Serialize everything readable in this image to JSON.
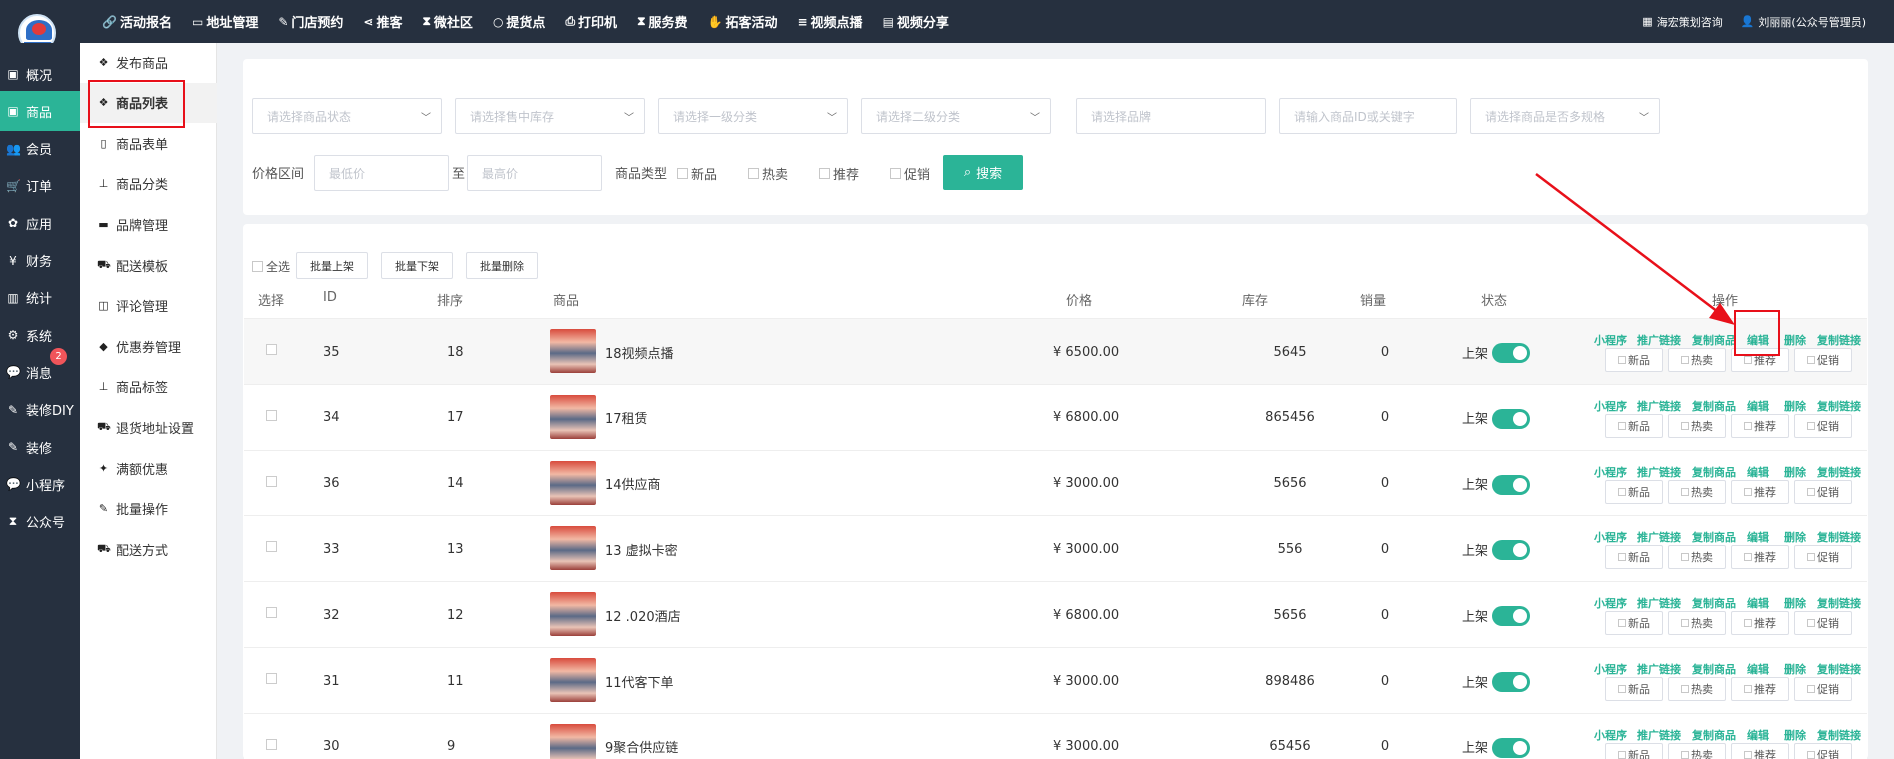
{
  "topbar": {
    "nav": [
      {
        "icon": "link-icon",
        "glyph": "🔗",
        "label": "活动报名"
      },
      {
        "icon": "card-icon",
        "glyph": "▭",
        "label": "地址管理"
      },
      {
        "icon": "pin-icon",
        "glyph": "✎",
        "label": "门店预约"
      },
      {
        "icon": "share-icon",
        "glyph": "⋖",
        "label": "推客"
      },
      {
        "icon": "hourglass-icon",
        "glyph": "⧗",
        "label": "微社区"
      },
      {
        "icon": "circle-icon",
        "glyph": "○",
        "label": "提货点"
      },
      {
        "icon": "print-icon",
        "glyph": "⎙",
        "label": "打印机"
      },
      {
        "icon": "hourglass-icon",
        "glyph": "⧗",
        "label": "服务费"
      },
      {
        "icon": "handshake-icon",
        "glyph": "✋",
        "label": "拓客活动"
      },
      {
        "icon": "list-icon",
        "glyph": "≡",
        "label": "视频点播"
      },
      {
        "icon": "table-icon",
        "glyph": "▤",
        "label": "视频分享"
      }
    ],
    "right": [
      {
        "icon": "grid-icon",
        "glyph": "▦",
        "label": "海宏策划咨询"
      },
      {
        "icon": "user-icon",
        "glyph": "👤",
        "label": "刘丽丽(公众号管理员)"
      }
    ]
  },
  "sidebar": [
    {
      "icon": "overview-icon",
      "glyph": "▣",
      "label": "概况"
    },
    {
      "icon": "goods-icon",
      "glyph": "▣",
      "label": "商品",
      "active": true
    },
    {
      "icon": "users-icon",
      "glyph": "👥",
      "label": "会员"
    },
    {
      "icon": "cart-icon",
      "glyph": "🛒",
      "label": "订单"
    },
    {
      "icon": "apps-icon",
      "glyph": "✿",
      "label": "应用"
    },
    {
      "icon": "yen-icon",
      "glyph": "¥",
      "label": "财务"
    },
    {
      "icon": "chart-icon",
      "glyph": "▥",
      "label": "统计"
    },
    {
      "icon": "gears-icon",
      "glyph": "⚙",
      "label": "系统"
    },
    {
      "icon": "message-icon",
      "glyph": "💬",
      "label": "消息",
      "badge": "2"
    },
    {
      "icon": "brush-icon",
      "glyph": "✎",
      "label": "装修DIY"
    },
    {
      "icon": "brush-icon",
      "glyph": "✎",
      "label": "装修"
    },
    {
      "icon": "wechat-icon",
      "glyph": "💬",
      "label": "小程序"
    },
    {
      "icon": "hourglass-icon",
      "glyph": "⧗",
      "label": "公众号"
    }
  ],
  "subnav": [
    {
      "icon": "cubes-icon",
      "glyph": "❖",
      "label": "发布商品"
    },
    {
      "icon": "cubes-icon",
      "glyph": "❖",
      "label": "商品列表",
      "active": true
    },
    {
      "icon": "file-icon",
      "glyph": "▯",
      "label": "商品表单"
    },
    {
      "icon": "sitemap-icon",
      "glyph": "⊥",
      "label": "商品分类"
    },
    {
      "icon": "briefcase-icon",
      "glyph": "▬",
      "label": "品牌管理"
    },
    {
      "icon": "truck-icon",
      "glyph": "⛟",
      "label": "配送模板"
    },
    {
      "icon": "columns-icon",
      "glyph": "◫",
      "label": "评论管理"
    },
    {
      "icon": "tags-icon",
      "glyph": "◆",
      "label": "优惠券管理"
    },
    {
      "icon": "sitemap-icon",
      "glyph": "⊥",
      "label": "商品标签"
    },
    {
      "icon": "truck-icon",
      "glyph": "⛟",
      "label": "退货地址设置"
    },
    {
      "icon": "gift-icon",
      "glyph": "✦",
      "label": "满额优惠"
    },
    {
      "icon": "edit-icon",
      "glyph": "✎",
      "label": "批量操作"
    },
    {
      "icon": "truck-icon",
      "glyph": "⛟",
      "label": "配送方式"
    }
  ],
  "filters": {
    "status_placeholder": "请选择商品状态",
    "stock_placeholder": "请选择售中库存",
    "cat1_placeholder": "请选择一级分类",
    "cat2_placeholder": "请选择二级分类",
    "brand_placeholder": "请选择品牌",
    "keyword_placeholder": "请输入商品ID或关键字",
    "spec_placeholder": "请选择商品是否多规格",
    "price_label": "价格区间",
    "min_placeholder": "最低价",
    "to_label": "至",
    "max_placeholder": "最高价",
    "type_label": "商品类型",
    "types": [
      "新品",
      "热卖",
      "推荐",
      "促销"
    ],
    "search_label": "搜索"
  },
  "bulk": {
    "select_all": "全选",
    "buttons": [
      "批量上架",
      "批量下架",
      "批量删除"
    ]
  },
  "columns": {
    "select": "选择",
    "id": "ID",
    "sort": "排序",
    "goods": "商品",
    "price": "价格",
    "stock": "库存",
    "sales": "销量",
    "status": "状态",
    "actions": "操作"
  },
  "ops": [
    "小程序",
    "推广链接",
    "复制商品",
    "编辑",
    "删除",
    "复制链接"
  ],
  "tags": [
    "新品",
    "热卖",
    "推荐",
    "促销"
  ],
  "rows": [
    {
      "id": "35",
      "sort": "18",
      "name": "18视频点播",
      "price": "¥ 6500.00",
      "stock": "5645",
      "sales": "0",
      "status": "上架"
    },
    {
      "id": "34",
      "sort": "17",
      "name": "17租赁",
      "price": "¥ 6800.00",
      "stock": "865456",
      "sales": "0",
      "status": "上架"
    },
    {
      "id": "36",
      "sort": "14",
      "name": "14供应商",
      "price": "¥ 3000.00",
      "stock": "5656",
      "sales": "0",
      "status": "上架"
    },
    {
      "id": "33",
      "sort": "13",
      "name": "13 虚拟卡密",
      "price": "¥ 3000.00",
      "stock": "556",
      "sales": "0",
      "status": "上架"
    },
    {
      "id": "32",
      "sort": "12",
      "name": "12 .020酒店",
      "price": "¥ 6800.00",
      "stock": "5656",
      "sales": "0",
      "status": "上架"
    },
    {
      "id": "31",
      "sort": "11",
      "name": "11代客下单",
      "price": "¥ 3000.00",
      "stock": "898486",
      "sales": "0",
      "status": "上架"
    },
    {
      "id": "30",
      "sort": "9",
      "name": "9聚合供应链",
      "price": "¥ 3000.00",
      "stock": "65456",
      "sales": "0",
      "status": "上架"
    }
  ],
  "colors": {
    "topbar": "#26303f",
    "accent": "#2bb497",
    "highlight": "#e8101a"
  }
}
